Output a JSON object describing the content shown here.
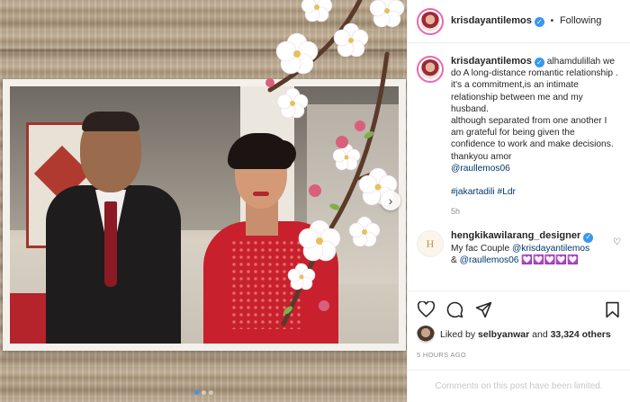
{
  "header": {
    "username": "krisdayantilemos",
    "separator": "•",
    "follow_status": "Following"
  },
  "caption": {
    "username": "krisdayantilemos",
    "lines": [
      "alhamdulillah we do A long-distance romantic relationship .",
      "it's a commitment,is an intimate relationship between me and my husband.",
      "although separated from one another I am grateful for being given the confidence to work and make decisions.",
      "thankyou amor"
    ],
    "mention": "@raullemos06",
    "hashtags": [
      "#jakartadili",
      "#Ldr"
    ],
    "time": "5h"
  },
  "comment": {
    "avatar_letter": "H",
    "username": "hengkikawilarang_designer",
    "text": "My fac Couple ",
    "mention1": "@krisdayantilemos",
    "line2_prefix": "& ",
    "mention2": "@raullemos06",
    "emojis": "💟💟💟💟💟"
  },
  "likes": {
    "prefix": "Liked by ",
    "user": "selbyanwar",
    "and": " and ",
    "count": "33,324 others"
  },
  "posted_ago": "5 HOURS AGO",
  "comments_limited": "Comments on this post have been limited.",
  "carousel": {
    "slides": 3,
    "active": 0
  },
  "colors": {
    "link": "#00376b",
    "verified": "#3897f0",
    "muted": "#8e8e8e"
  }
}
